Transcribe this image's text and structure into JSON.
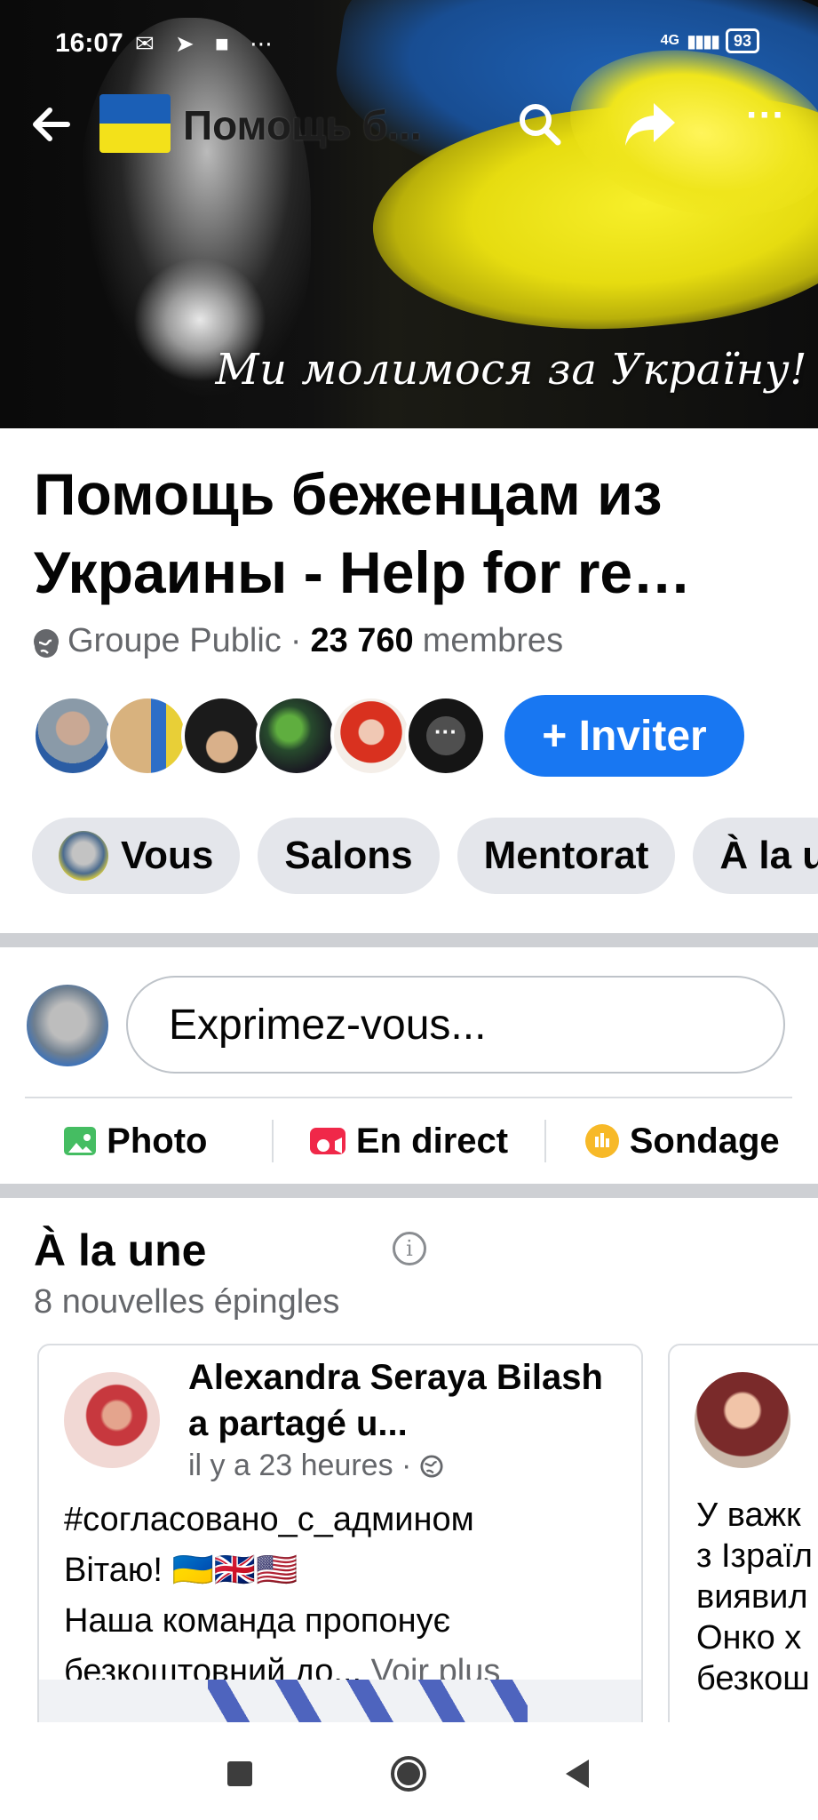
{
  "status_bar": {
    "time": "16:07",
    "icons": "✉ ➤ ■ ⋯",
    "network": "4G",
    "signal": "▮▮▮▮",
    "battery": "93"
  },
  "top_nav": {
    "back_icon": "arrow-left",
    "title": "Помощь б...",
    "search_icon": "magnifier",
    "share_icon": "share-arrow",
    "more_label": "···"
  },
  "cover": {
    "caption": "Ми молимося за Україну!",
    "flag_colors": [
      "#1f63b8",
      "#f7ef2a"
    ]
  },
  "group": {
    "title": "Помощь беженцам из Украины - Help for re…",
    "privacy": "Groupe Public",
    "separator": "·",
    "member_count": "23 760",
    "members_label": "membres",
    "more_members": "···",
    "invite_label": "+ Inviter",
    "accent_color": "#1877f2"
  },
  "chips": [
    {
      "label": "Vous"
    },
    {
      "label": "Salons"
    },
    {
      "label": "Mentorat"
    },
    {
      "label": "À la u"
    }
  ],
  "composer": {
    "placeholder": "Exprimez-vous...",
    "actions": [
      {
        "label": "Photo",
        "icon": "photo-icon"
      },
      {
        "label": "En direct",
        "icon": "live-video-icon"
      },
      {
        "label": "Sondage",
        "icon": "poll-icon"
      }
    ]
  },
  "featured": {
    "title": "À la une",
    "subtitle": "8 nouvelles épingles",
    "cards": [
      {
        "author": "Alexandra Seraya Bilash a partagé u...",
        "time": "il y a 23 heures · ",
        "lines": [
          "#согласовано_с_админом",
          "Вітаю! 🇺🇦🇬🇧🇺🇸",
          "Наша команда пропонує",
          "безкоштовний до..."
        ],
        "more": "Voir plus"
      },
      {
        "lines": [
          "У важк",
          "з Ізраїл",
          "виявил",
          "Онко х",
          "безкош"
        ]
      }
    ]
  }
}
